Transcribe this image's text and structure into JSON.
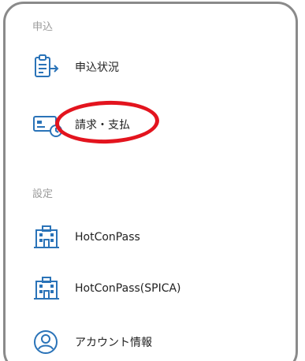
{
  "sections": {
    "apply": {
      "label": "申込",
      "items": [
        {
          "label": "申込状況",
          "icon": "clipboard-arrow-icon"
        },
        {
          "label": "請求・支払",
          "icon": "card-clock-icon"
        }
      ]
    },
    "settings": {
      "label": "設定",
      "items": [
        {
          "label": "HotConPass",
          "icon": "hotel-building-icon"
        },
        {
          "label": "HotConPass(SPICA)",
          "icon": "hotel-building-icon"
        },
        {
          "label": "アカウント情報",
          "icon": "account-circle-icon"
        }
      ]
    }
  },
  "colors": {
    "accent": "#2a73b8",
    "highlight": "#e3141e",
    "text": "#222222",
    "section_label": "#9b9b9b"
  }
}
